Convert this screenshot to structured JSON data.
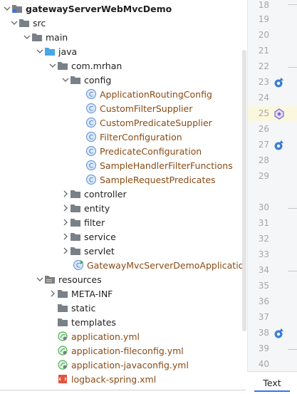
{
  "tree": {
    "project": "gatewayServerWebMvcDemo",
    "items": [
      {
        "label": "src"
      },
      {
        "label": "main"
      },
      {
        "label": "java"
      },
      {
        "label": "com.mrhan"
      },
      {
        "label": "config"
      },
      {
        "label": "ApplicationRoutingConfig"
      },
      {
        "label": "CustomFilterSupplier"
      },
      {
        "label": "CustomPredicateSupplier"
      },
      {
        "label": "FilterConfiguration"
      },
      {
        "label": "PredicateConfiguration"
      },
      {
        "label": "SampleHandlerFilterFunctions"
      },
      {
        "label": "SampleRequestPredicates"
      },
      {
        "label": "controller"
      },
      {
        "label": "entity"
      },
      {
        "label": "filter"
      },
      {
        "label": "service"
      },
      {
        "label": "servlet"
      },
      {
        "label": "GatewayMvcServerDemoApplication"
      },
      {
        "label": "resources"
      },
      {
        "label": "META-INF"
      },
      {
        "label": "static"
      },
      {
        "label": "templates"
      },
      {
        "label": "application.yml"
      },
      {
        "label": "application-fileconfig.yml"
      },
      {
        "label": "application-javaconfig.yml"
      },
      {
        "label": "logback-spring.xml"
      }
    ]
  },
  "gutter": {
    "lines": [
      "18",
      "19",
      "20",
      "21",
      "22",
      "23",
      "24",
      "25",
      "26",
      "27",
      "28",
      "29",
      "30",
      "31",
      "32",
      "33",
      "34",
      "35",
      "36",
      "37",
      "38",
      "39",
      "40"
    ]
  },
  "bottom_tab": {
    "label": "Text"
  },
  "colors": {
    "accent": "#3574f0",
    "class_text": "#8a4a14",
    "folder": "#7a8087",
    "highlight": "#fbf7df"
  }
}
